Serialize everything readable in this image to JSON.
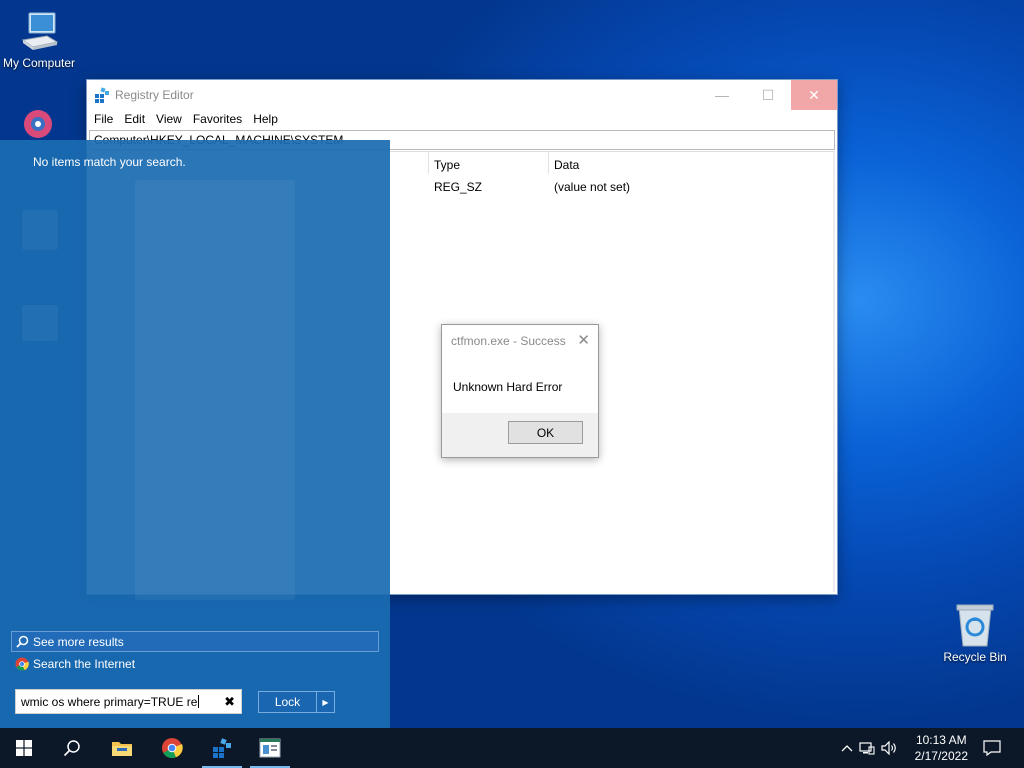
{
  "desktop": {
    "icons": [
      {
        "label": "My Computer"
      },
      {
        "label": "Recycle Bin"
      }
    ]
  },
  "regedit": {
    "title": "Registry Editor",
    "menu": [
      "File",
      "Edit",
      "View",
      "Favorites",
      "Help"
    ],
    "address": "Computer\\HKEY_LOCAL_MACHINE\\SYSTEM",
    "columns": {
      "type": "Type",
      "data": "Data"
    },
    "row": {
      "type": "REG_SZ",
      "data": "(value not set)"
    }
  },
  "msgbox": {
    "title": "ctfmon.exe - Success",
    "message": "Unknown Hard Error",
    "ok_label": "OK"
  },
  "start_search": {
    "no_results": "No items match your search.",
    "see_more": "See more results",
    "search_internet": "Search the Internet",
    "query": "wmic os where primary=TRUE re",
    "lock_label": "Lock"
  },
  "taskbar": {
    "time": "10:13 AM",
    "date": "2/17/2022"
  },
  "colors": {
    "accent": "#0a62d6",
    "panel": "#1a6cb2",
    "taskbar": "#0c1828"
  }
}
